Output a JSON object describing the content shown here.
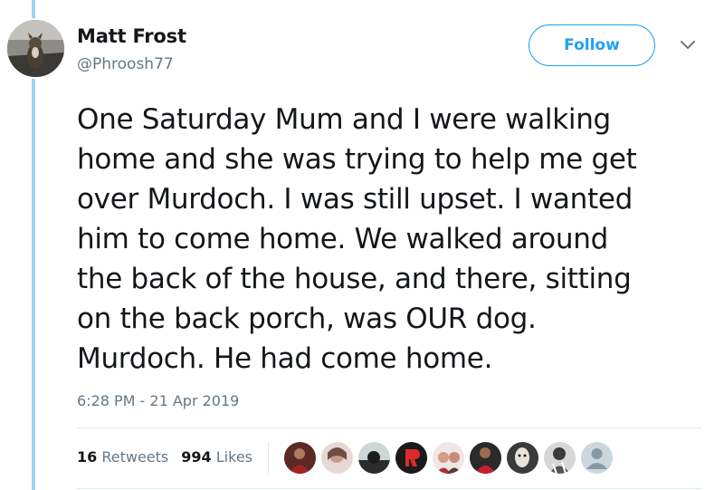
{
  "author": {
    "name": "Matt Frost",
    "handle": "@Phroosh77",
    "avatar_icon": "dog-photo-avatar"
  },
  "follow_button": {
    "label": "Follow"
  },
  "menu_icon": "chevron-down-icon",
  "tweet": {
    "lines": [
      "One Saturday Mum and I were walking",
      "home and she was trying to help me get",
      "over Murdoch. I was still upset. I wanted",
      "him to come home. We walked around",
      "the back of the house, and there, sitting",
      "on the back porch, was OUR dog.",
      "Murdoch. He had come home."
    ],
    "timestamp": "6:28 PM - 21 Apr 2019"
  },
  "stats": {
    "retweets_count": "16",
    "retweets_label": "Retweets",
    "likes_count": "994",
    "likes_label": "Likes"
  },
  "likers": [
    "liker-avatar-1",
    "liker-avatar-2",
    "liker-avatar-3",
    "liker-avatar-4",
    "liker-avatar-5",
    "liker-avatar-6",
    "liker-avatar-7",
    "liker-avatar-8",
    "liker-avatar-9"
  ],
  "colors": {
    "accent": "#1da1f2",
    "thread_line": "#9fd4f5",
    "secondary_text": "#657786",
    "primary_text": "#14171a",
    "divider": "#e1e8ed"
  }
}
